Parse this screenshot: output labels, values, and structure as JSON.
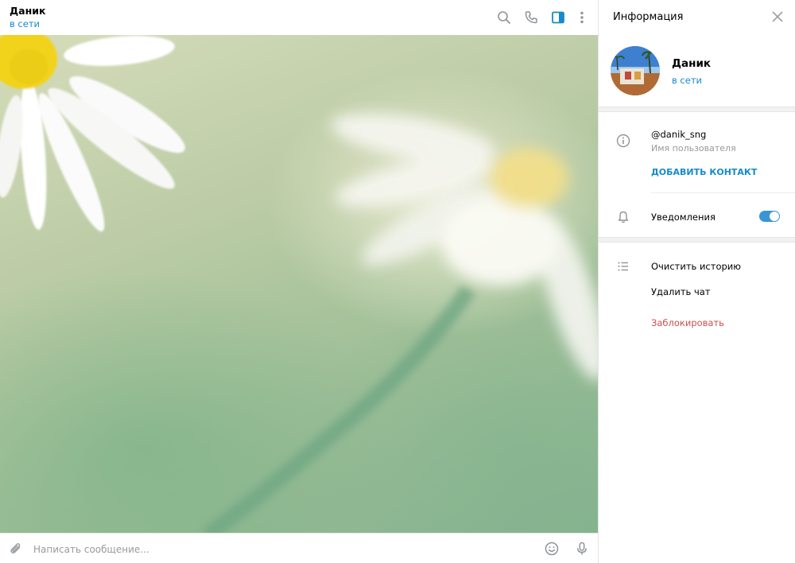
{
  "chat": {
    "contact_name": "Даник",
    "contact_status": "в сети",
    "composer_placeholder": "Написать сообщение..."
  },
  "header_icons": [
    "search-icon",
    "phone-icon",
    "sidebar-panel-icon",
    "more-vertical-icon"
  ],
  "composer_icons": [
    "paperclip-icon",
    "emoji-icon",
    "microphone-icon"
  ],
  "info_panel": {
    "title": "Информация",
    "profile_name": "Даник",
    "profile_status": "в сети",
    "username": "@danik_sng",
    "username_label": "Имя пользователя",
    "add_contact": "ДОБАВИТЬ КОНТАКТ",
    "notifications_label": "Уведомления",
    "notifications_enabled": true,
    "clear_history": "Очистить историю",
    "delete_chat": "Удалить чат",
    "block": "Заблокировать"
  },
  "colors": {
    "accent": "#168acd",
    "toggle_on": "#3a95d5",
    "danger": "#d14e4e"
  }
}
